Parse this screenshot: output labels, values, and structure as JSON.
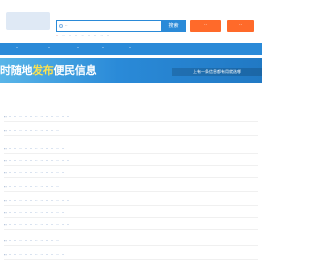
{
  "header": {
    "search_placeholder": "··",
    "search_button": "搜索",
    "hot_words_title": "··",
    "hot_words": [
      "··",
      "··",
      "··",
      "··",
      "··",
      "··",
      "··",
      "··"
    ],
    "post_button": "··",
    "mine_button": "··"
  },
  "nav": {
    "items": [
      {
        "label": "··"
      },
      {
        "label": "··"
      },
      {
        "label": "··"
      },
      {
        "label": "··"
      },
      {
        "label": "··"
      }
    ]
  },
  "banner": {
    "title_prefix": "时随地",
    "title_accent": "发布",
    "title_suffix": "便民信息",
    "subtitle": "上有一条信息都有用就选哪"
  },
  "regions": [
    {
      "province": "··",
      "cities": [
        "··",
        "··",
        "··",
        "··",
        "··",
        "··",
        "··",
        "··",
        "··",
        "··",
        "··",
        "··"
      ]
    },
    {
      "province": "··",
      "cities": [
        "··",
        "··",
        "··",
        "··",
        "··",
        "··",
        "··",
        "··",
        "··",
        "··"
      ]
    },
    {
      "province": "··",
      "cities": [
        "··",
        "··",
        "··",
        "··",
        "··",
        "··",
        "··",
        "··",
        "··",
        "··",
        "··"
      ]
    },
    {
      "province": "··",
      "cities": [
        "··",
        "··",
        "··",
        "··",
        "··",
        "··",
        "··",
        "··",
        "··",
        "··",
        "··",
        "··"
      ]
    },
    {
      "province": "··",
      "cities": [
        "··",
        "··",
        "··",
        "··",
        "··",
        "··",
        "··",
        "··",
        "··",
        "··",
        "··"
      ]
    },
    {
      "province": "··",
      "cities": [
        "··",
        "··",
        "··",
        "··",
        "··",
        "··",
        "··",
        "··",
        "··",
        "··"
      ]
    },
    {
      "province": "··",
      "cities": [
        "··",
        "··",
        "··",
        "··",
        "··",
        "··",
        "··",
        "··",
        "··",
        "··",
        "··",
        "··"
      ]
    },
    {
      "province": "··",
      "cities": [
        "··",
        "··",
        "··",
        "··",
        "··",
        "··",
        "··",
        "··",
        "··",
        "··",
        "··"
      ]
    },
    {
      "province": "··",
      "cities": [
        "··",
        "··",
        "··",
        "··",
        "··",
        "··",
        "··",
        "··",
        "··",
        "··",
        "··",
        "··"
      ]
    },
    {
      "province": "··",
      "cities": [
        "··",
        "··",
        "··",
        "··",
        "··",
        "··",
        "··",
        "··",
        "··",
        "··"
      ]
    },
    {
      "province": "··",
      "cities": [
        "··",
        "··",
        "··",
        "··",
        "··",
        "··",
        "··",
        "··",
        "··",
        "··",
        "··"
      ]
    }
  ],
  "colors": {
    "accent": "#2a8ad8",
    "post_button": "#ff6a2a",
    "banner_accent": "#ffe34d"
  }
}
